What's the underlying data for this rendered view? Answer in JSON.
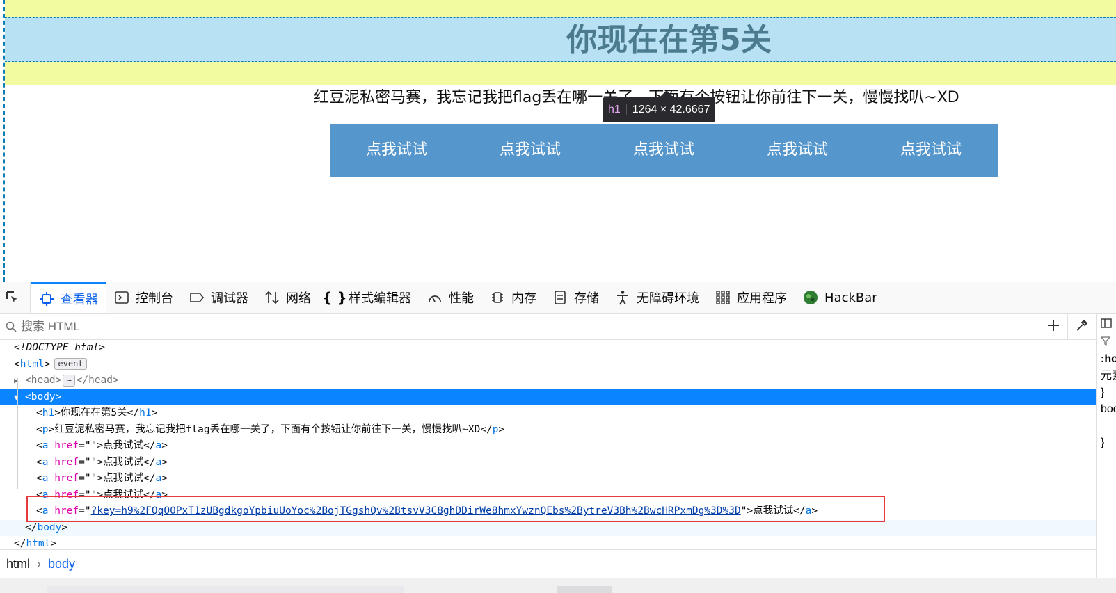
{
  "page": {
    "heading": "你现在在第5关",
    "paragraph": "红豆泥私密马赛，我忘记我把flag丢在哪一关了，下面有个按钮让你前往下一关，慢慢找叭~XD",
    "buttons": [
      "点我试试",
      "点我试试",
      "点我试试",
      "点我试试",
      "点我试试"
    ],
    "tooltip": {
      "tag": "h1",
      "size": "1264 × 42.6667"
    }
  },
  "devtools": {
    "tabs": [
      {
        "label": "查看器",
        "icon": "inspector-icon"
      },
      {
        "label": "控制台",
        "icon": "console-icon"
      },
      {
        "label": "调试器",
        "icon": "debugger-icon"
      },
      {
        "label": "网络",
        "icon": "network-icon"
      },
      {
        "label": "样式编辑器",
        "icon": "style-editor-icon"
      },
      {
        "label": "性能",
        "icon": "performance-icon"
      },
      {
        "label": "内存",
        "icon": "memory-icon"
      },
      {
        "label": "存储",
        "icon": "storage-icon"
      },
      {
        "label": "无障碍环境",
        "icon": "accessibility-icon"
      },
      {
        "label": "应用程序",
        "icon": "application-icon"
      },
      {
        "label": "HackBar",
        "icon": "hackbar-icon"
      }
    ],
    "active_tab": "查看器",
    "search_placeholder": "搜索 HTML",
    "tree": {
      "doctype": "<!DOCTYPE html>",
      "html_tag": "html",
      "event_badge": "event",
      "head_tag": "head",
      "body_tag": "body",
      "h1_text": "你现在在第5关",
      "p_text": "红豆泥私密马赛，我忘记我把flag丢在哪一关了，下面有个按钮让你前往下一关，慢慢找叭~XD",
      "links": [
        {
          "href": "",
          "text": "点我试试"
        },
        {
          "href": "",
          "text": "点我试试"
        },
        {
          "href": "",
          "text": "点我试试"
        },
        {
          "href": "",
          "text": "点我试试"
        },
        {
          "href": "?key=h9%2FQqO0PxT1zUBgdkgoYpbiuUoYoc%2BojTGgshQv%2BtsvV3C8ghDDirWe8hmxYwznQEbs%2BytreV3Bh%2BwcHRPxmDg%3D%3D",
          "text": "点我试试"
        }
      ]
    },
    "breadcrumbs": [
      "html",
      "body"
    ],
    "side_pane": [
      ":ho",
      "元素",
      "}",
      "boc",
      "",
      "}"
    ],
    "colors": {
      "accent": "#0a84ff",
      "selection": "#0a84ff",
      "highlight_box": "#e83a3a"
    }
  }
}
